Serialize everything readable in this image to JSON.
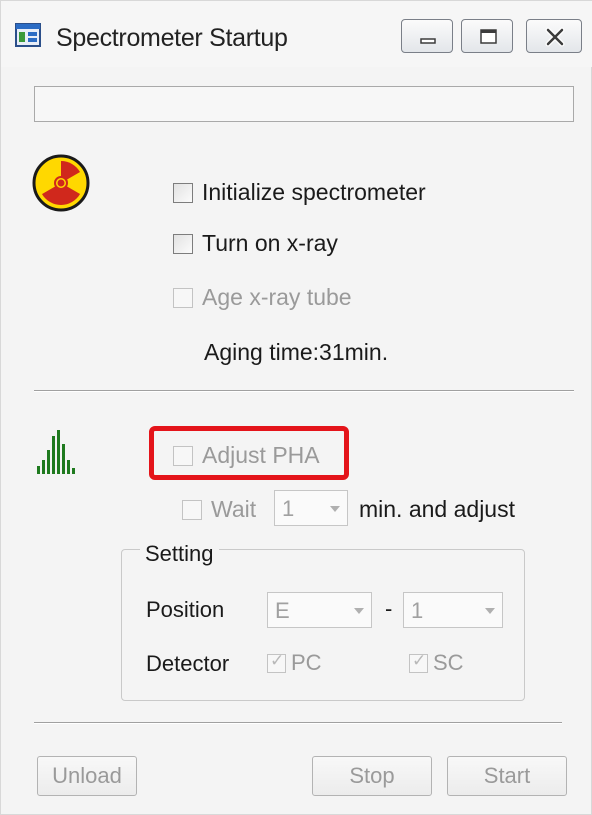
{
  "window": {
    "title": "Spectrometer Startup",
    "controls": [
      "minimize-icon",
      "maximize-icon",
      "close-icon"
    ]
  },
  "status_text": "",
  "xray": {
    "icon": "radiation-icon",
    "initialize_label": "Initialize spectrometer",
    "initialize_checked": false,
    "turn_on_label": "Turn on x-ray",
    "turn_on_checked": false,
    "age_label": "Age x-ray tube",
    "age_checked": false,
    "aging_time": "Aging time:31min."
  },
  "pha": {
    "icon": "spectrum-peaks-icon",
    "adjust_label": "Adjust PHA",
    "adjust_checked": false,
    "wait_label": "Wait",
    "wait_value": "1",
    "wait_suffix": "min. and adjust"
  },
  "setting": {
    "group_label": "Setting",
    "position_label": "Position",
    "position_value_1": "E",
    "position_separator": "-",
    "position_value_2": "1",
    "detector_label": "Detector",
    "detectors": [
      {
        "label": "PC",
        "checked": true
      },
      {
        "label": "SC",
        "checked": true
      }
    ]
  },
  "buttons": {
    "unload": "Unload",
    "stop": "Stop",
    "start": "Start"
  },
  "colors": {
    "highlight": "#e4141a",
    "radiation_fill": "#ffd800",
    "radiation_symbol": "#d0281c",
    "spectrum_green": "#1f7a1f"
  }
}
